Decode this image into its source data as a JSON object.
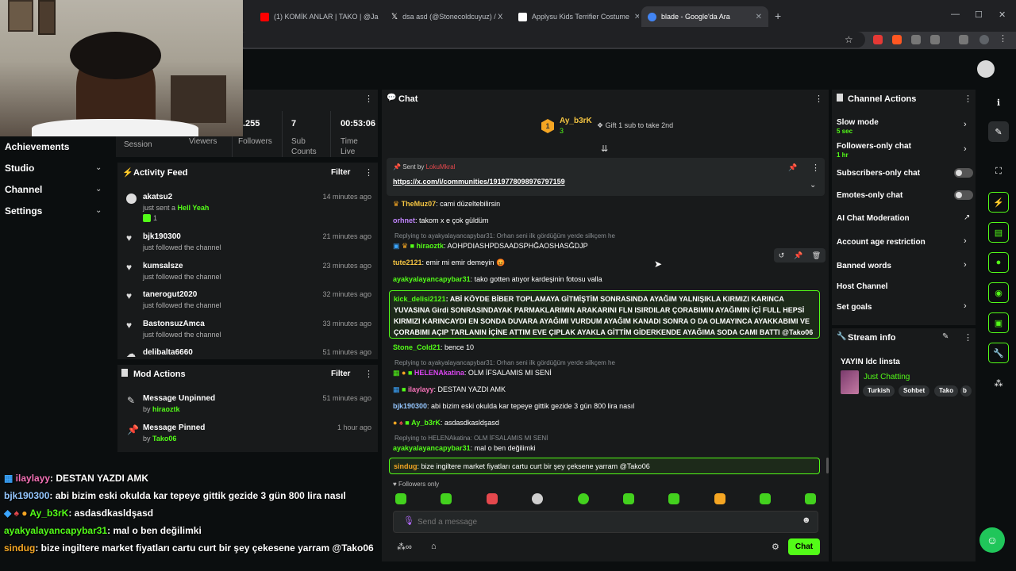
{
  "browser": {
    "tabs": [
      {
        "title": "(1) KOMİK ANLAR | TAKO | @Ja",
        "icon": "youtube-icon",
        "color": "#ff0000"
      },
      {
        "title": "dsa asd (@Stonecoldcuyuz) / X",
        "icon": "x-icon",
        "color": "#ffffff"
      },
      {
        "title": "Applysu Kids Terrifier Costume",
        "icon": "shop-icon",
        "color": "#ffffff"
      },
      {
        "title": "blade - Google'da Ara",
        "icon": "google-icon",
        "color": "#4285f4"
      }
    ],
    "new_tab": "+"
  },
  "stats": [
    {
      "value": ".255",
      "label": "Session"
    },
    {
      "value": "",
      "label": "Viewers"
    },
    {
      "value": "",
      "label": "Followers"
    },
    {
      "value": "7",
      "label": "Sub Counts"
    },
    {
      "value": "00:53:06",
      "label": "Time Live"
    }
  ],
  "sidebar": {
    "items": [
      {
        "label": "Achievements"
      },
      {
        "label": "Studio"
      },
      {
        "label": "Channel"
      },
      {
        "label": "Settings"
      }
    ]
  },
  "activity_feed": {
    "title": "Activity Feed",
    "filter": "Filter",
    "items": [
      {
        "name": "akatsu2",
        "sub": "just sent a ",
        "extra": "Hell Yeah",
        "count": "1",
        "time": "14 minutes ago"
      },
      {
        "name": "bjk190300",
        "sub": "just followed the channel",
        "time": "21 minutes ago"
      },
      {
        "name": "kumsalsze",
        "sub": "just followed the channel",
        "time": "23 minutes ago"
      },
      {
        "name": "tanerogut2020",
        "sub": "just followed the channel",
        "time": "32 minutes ago"
      },
      {
        "name": "BastonsuzAmca",
        "sub": "just followed the channel",
        "time": "33 minutes ago"
      },
      {
        "name": "delibalta6660",
        "sub": "",
        "time": "51 minutes ago"
      }
    ]
  },
  "mod_actions": {
    "title": "Mod Actions",
    "filter": "Filter",
    "items": [
      {
        "action": "Message Unpinned",
        "by": "by ",
        "user": "hiraoztk",
        "time": "51 minutes ago"
      },
      {
        "action": "Message Pinned",
        "by": "by ",
        "user": "Tako06",
        "time": "1 hour ago"
      }
    ]
  },
  "chat": {
    "title": "Chat",
    "gifter": {
      "rank": "1",
      "name": "Ay_b3rK",
      "count": "3",
      "cta": "Gift 1 sub to take 2nd"
    },
    "pinned": {
      "sent_by": "Sent by",
      "user": "LokuMkral",
      "link": "https://x.com/i/communities/1919778098976797159"
    },
    "messages": [
      {
        "user": "TheMuz07",
        "color": "#f5c542",
        "text": ": cami düzeltebilirsin"
      },
      {
        "user": "orhnet",
        "color": "#c084fc",
        "text": ": takom x e çok güldüm"
      },
      {
        "reply": "Replying to ayakyalayancapybar31: Orhan seni ilk gördüğüm yerde silkçem he"
      },
      {
        "user": "hiraoztk",
        "color": "#53fc18",
        "text": ": AOHPDIASHPDSAADSPHĞAOSHASĞDJP"
      },
      {
        "user": "tute2121",
        "color": "#f5c542",
        "text": ": emir mi emir demeyin 😡"
      },
      {
        "user": "ayakyalayancapybar31",
        "color": "#53fc18",
        "text": ": tako gotten atıyor kardeşinin fotosu valla"
      },
      {
        "user": "Stone_Cold21",
        "color": "#53fc18",
        "text": ": bence 10"
      },
      {
        "reply": "Replying to ayakyalayancapybar31: Orhan seni ilk gördüğüm yerde silkçem he"
      },
      {
        "user": "HELENAkatina",
        "color": "#d946ef",
        "text": ": OLM İFSALAMIS MI SENİ"
      },
      {
        "user": "ilaylayy",
        "color": "#f472b6",
        "text": ": DESTAN YAZDI AMK"
      },
      {
        "user": "bjk190300",
        "color": "#93c5fd",
        "text": ": abi bizim eski okulda kar tepeye gittik gezide 3 gün 800 lira nasıl"
      },
      {
        "user": "Ay_b3rK",
        "color": "#53fc18",
        "text": ": asdasdkasldşasd"
      },
      {
        "reply": "Replying to HELENAkatina: OLM İFSALAMIS MI SENİ"
      },
      {
        "user": "ayakyalayancapybar31",
        "color": "#53fc18",
        "text": ": mal o ben değilimki"
      }
    ],
    "highlight1": {
      "user": "kick_delisi2121",
      "text": ": ABİ KÖYDE BİBER TOPLAMAYA GİTMİŞTİM SONRASINDA AYAĞIM YALNIŞIKLA KIRMIZI KARINCA YUVASINA Girdi SONRASINDAYAK PARMAKLARIMIN ARAKARINI FLN ISIRDILAR ÇORABIMIN AYAĞIMIN İÇİ FULL HEPSİ KIRMIZI KARINCAYDI EN SONDA DUVARA AYAĞIMI VURDUM AYAĞIM KANADI SONRA O DA OLMAYINCA AYAKKABIMI VE ÇORABIMI AÇIP TARLANIN İÇİNE ATTIM EVE ÇIPLAK AYAKLA GİTTİM GİDERKENDE AYAĞIMA SODA CAMI BATTI @Tako06"
    },
    "highlight2": {
      "user": "sindug",
      "text": ": bize ingiltere market fiyatları cartu curt bir şey çeksene yarram @Tako06"
    },
    "mode": "Followers only",
    "placeholder": "Send a message",
    "send": "Chat"
  },
  "channel_actions": {
    "title": "Channel Actions",
    "items": [
      {
        "label": "Slow mode",
        "sub": "5 sec",
        "kind": "chevron"
      },
      {
        "label": "Followers-only chat",
        "sub": "1 hr",
        "kind": "chevron"
      },
      {
        "label": "Subscribers-only chat",
        "sub": "",
        "kind": "toggle"
      },
      {
        "label": "Emotes-only chat",
        "sub": "",
        "kind": "toggle"
      },
      {
        "label": "AI Chat Moderation",
        "sub": "",
        "kind": "external"
      },
      {
        "label": "Account age restriction",
        "sub": "",
        "kind": "chevron"
      },
      {
        "label": "Banned words",
        "sub": "",
        "kind": "chevron"
      },
      {
        "label": "Host Channel",
        "sub": "",
        "kind": "none"
      },
      {
        "label": "Set goals",
        "sub": "",
        "kind": "chevron"
      }
    ]
  },
  "stream_info": {
    "title": "Stream info",
    "stream_title": "YAYIN ldc linsta",
    "category": "Just Chatting",
    "tags": [
      "Turkish",
      "Sohbet",
      "Tako",
      "b"
    ]
  },
  "overlay_chat": [
    {
      "user": "ilaylayy",
      "color": "#f472b6",
      "text": ": DESTAN YAZDI AMK"
    },
    {
      "user": "bjk190300",
      "color": "#93c5fd",
      "text": ": abi bizim eski okulda kar tepeye gittik gezide 3 gün 800 lira nasıl"
    },
    {
      "user": "Ay_b3rK",
      "color": "#53fc18",
      "text": ": asdasdkasldşasd"
    },
    {
      "user": "ayakyalayancapybar31",
      "color": "#53fc18",
      "text": ": mal o ben değilimki"
    },
    {
      "user": "sindug",
      "color": "#f5a623",
      "text": ": bize ingiltere market fiyatları cartu curt bir şey çekesene yarram @Tako06"
    }
  ],
  "colors": {
    "accent": "#53fc18",
    "panel": "#181a1b",
    "bg": "#0b0e0f"
  }
}
